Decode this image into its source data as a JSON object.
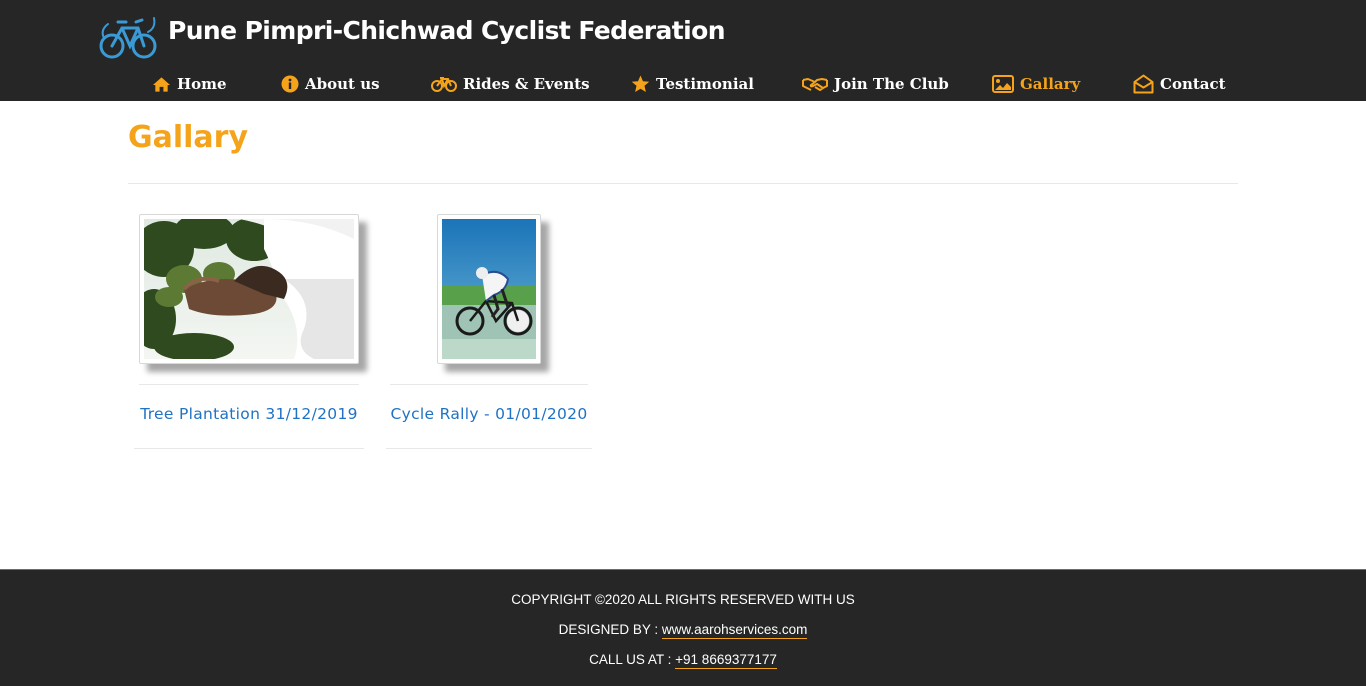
{
  "header": {
    "site_title": "Pune Pimpri-Chichwad Cyclist Federation",
    "logo_icon": "bicycle-logo-icon",
    "nav": [
      {
        "label": "Home",
        "icon": "home-icon",
        "active": false
      },
      {
        "label": "About us",
        "icon": "info-icon",
        "active": false
      },
      {
        "label": "Rides & Events",
        "icon": "bicycle-icon",
        "active": false
      },
      {
        "label": "Testimonial",
        "icon": "star-icon",
        "active": false
      },
      {
        "label": "Join The Club",
        "icon": "handshake-icon",
        "active": false
      },
      {
        "label": "Gallary",
        "icon": "image-icon",
        "active": true
      },
      {
        "label": "Contact",
        "icon": "envelope-open-icon",
        "active": false
      }
    ]
  },
  "main": {
    "title": "Gallary",
    "albums": [
      {
        "caption": "Tree Plantation 31/12/2019"
      },
      {
        "caption": "Cycle Rally - 01/01/2020"
      }
    ]
  },
  "footer": {
    "copyright": "COPYRIGHT ©2020 ALL RIGHTS RESERVED WITH US",
    "designed_by_label": "DESIGNED BY :",
    "designed_by_link": "www.aarohservices.com",
    "call_label": "CALL US AT :",
    "call_link": "+91 8669377177"
  },
  "colors": {
    "header_bg": "#262626",
    "accent": "#f5a31a",
    "link": "#1f72c4",
    "footer_bg": "#262626"
  }
}
